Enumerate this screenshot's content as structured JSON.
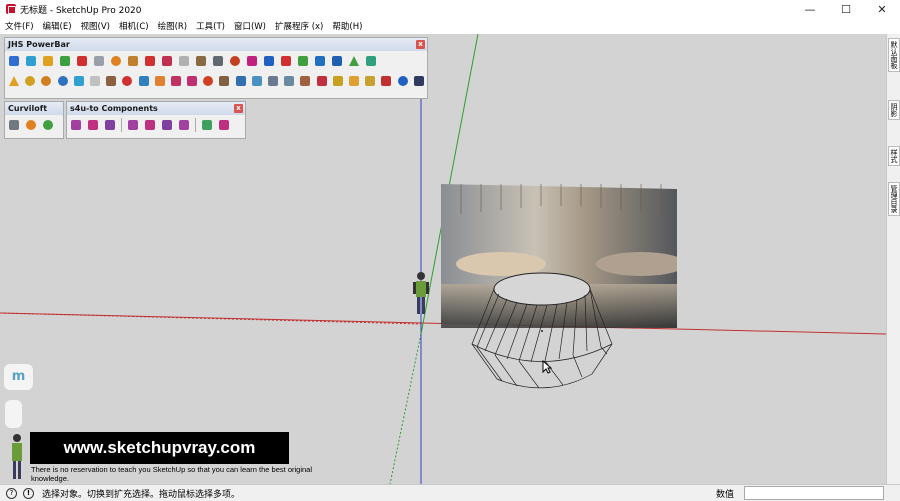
{
  "window": {
    "title": "无标题 - SketchUp Pro 2020"
  },
  "menu": [
    "文件(F)",
    "编辑(E)",
    "视图(V)",
    "相机(C)",
    "绘图(R)",
    "工具(T)",
    "窗口(W)",
    "扩展程序 (x)",
    "帮助(H)"
  ],
  "toolbars": {
    "powerbar": {
      "title": "JHS PowerBar",
      "close_label": "x"
    },
    "curviloft": {
      "title": "Curviloft",
      "close_label": "x"
    },
    "s4u": {
      "title": "s4u-to Components",
      "close_label": "x"
    }
  },
  "right_panel": {
    "tabs": [
      "默认面板",
      "阴影",
      "样式",
      "管理目录"
    ]
  },
  "watermark": {
    "title": "www.sketchupvray.com",
    "subtitle": "There is no reservation to teach you SketchUp so that you can learn the best original knowledge."
  },
  "viewport": {
    "m_label": "m"
  },
  "status": {
    "text": "选择对象。切换到扩充选择。拖动鼠标选择多项。",
    "measure_label": "数值"
  },
  "colors": {
    "accent_red": "#c8102e",
    "axis_green": "#2ca02c",
    "axis_red": "#c03030",
    "axis_blue": "#3040c0"
  }
}
